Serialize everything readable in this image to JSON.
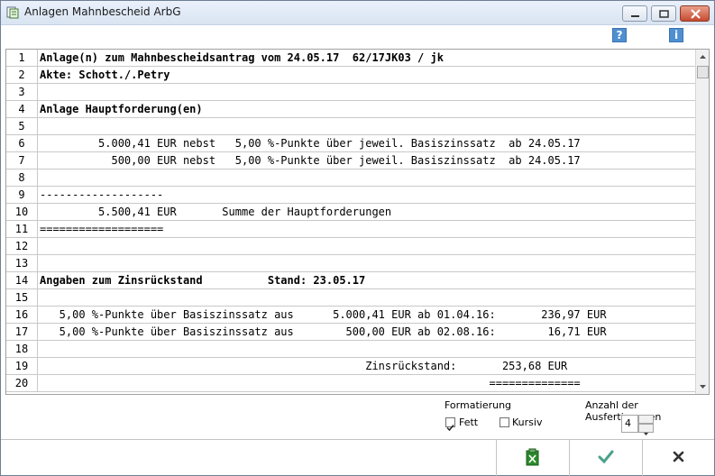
{
  "window": {
    "title": "Anlagen Mahnbescheid ArbG"
  },
  "toolbar": {
    "help_icon": "help-icon",
    "info_icon": "info-icon"
  },
  "rows": [
    {
      "num": "1",
      "text": "Anlage(n) zum Mahnbescheidsantrag vom 24.05.17  62/17JK03 / jk",
      "bold": true
    },
    {
      "num": "2",
      "text": "Akte: Schott./.Petry",
      "bold": true
    },
    {
      "num": "3",
      "text": "",
      "bold": false
    },
    {
      "num": "4",
      "text": "Anlage Hauptforderung(en)",
      "bold": true
    },
    {
      "num": "5",
      "text": "",
      "bold": false
    },
    {
      "num": "6",
      "text": "         5.000,41 EUR nebst   5,00 %-Punkte über jeweil. Basiszinssatz  ab 24.05.17",
      "bold": false
    },
    {
      "num": "7",
      "text": "           500,00 EUR nebst   5,00 %-Punkte über jeweil. Basiszinssatz  ab 24.05.17",
      "bold": false
    },
    {
      "num": "8",
      "text": "",
      "bold": false
    },
    {
      "num": "9",
      "text": "-------------------",
      "bold": false
    },
    {
      "num": "10",
      "text": "         5.500,41 EUR       Summe der Hauptforderungen",
      "bold": false
    },
    {
      "num": "11",
      "text": "===================",
      "bold": false
    },
    {
      "num": "12",
      "text": "",
      "bold": false
    },
    {
      "num": "13",
      "text": "",
      "bold": false
    },
    {
      "num": "14",
      "text": "Angaben zum Zinsrückstand          Stand: 23.05.17",
      "bold": true
    },
    {
      "num": "15",
      "text": "",
      "bold": false
    },
    {
      "num": "16",
      "text": "   5,00 %-Punkte über Basiszinssatz aus      5.000,41 EUR ab 01.04.16:       236,97 EUR",
      "bold": false
    },
    {
      "num": "17",
      "text": "   5,00 %-Punkte über Basiszinssatz aus        500,00 EUR ab 02.08.16:        16,71 EUR",
      "bold": false
    },
    {
      "num": "18",
      "text": "",
      "bold": false
    },
    {
      "num": "19",
      "text": "                                                  Zinsrückstand:       253,68 EUR",
      "bold": false
    },
    {
      "num": "20",
      "text": "                                                                     ==============",
      "bold": false
    }
  ],
  "options": {
    "format_label": "Formatierung",
    "bold_label": "Fett",
    "bold_checked": true,
    "italic_label": "Kursiv",
    "italic_checked": false,
    "copies_label": "Anzahl der Ausfertigungen",
    "copies_value": "4"
  },
  "footer": {
    "report_icon": "clipboard-icon",
    "ok_icon": "checkmark-icon",
    "cancel_icon": "x-icon"
  }
}
